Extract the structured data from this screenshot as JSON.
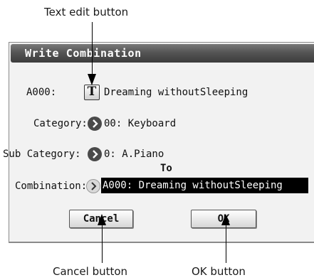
{
  "callouts": {
    "text_edit": "Text edit button",
    "cancel": "Cancel button",
    "ok": "OK button"
  },
  "dialog": {
    "title": "Write Combination",
    "program_label": "A000:",
    "text_edit_glyph": "T",
    "name_value": "Dreaming withoutSleeping",
    "category_label": "Category:",
    "category_value": "00: Keyboard",
    "subcategory_label": "Sub Category:",
    "subcategory_value": "0: A.Piano",
    "to_label": "To",
    "combination_label": "Combination:",
    "combination_value": "A000: Dreaming withoutSleeping",
    "cancel_label": "Cancel",
    "ok_label": "OK"
  }
}
